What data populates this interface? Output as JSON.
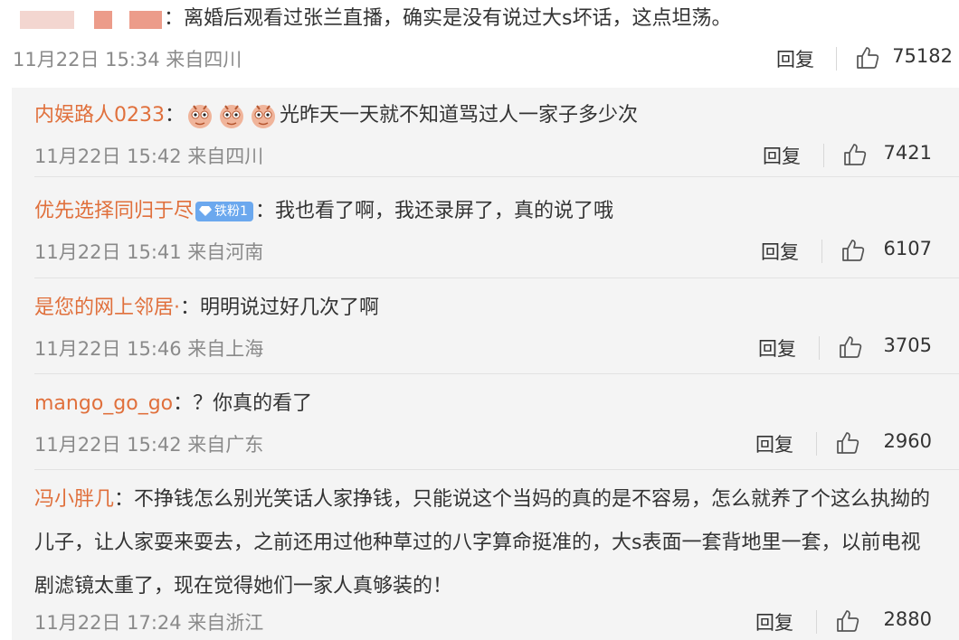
{
  "main_comment": {
    "text": "：离婚后观看过张兰直播，确实是没有说过大s坏话，这点坦荡。",
    "meta": "11月22日 15:34 来自四川",
    "reply_label": "回复",
    "likes": "75182"
  },
  "colors": {
    "username": "#e0703c",
    "panel_bg": "#f4f4f4",
    "badge": "#6ba8ee",
    "meta": "#8a8a8a"
  },
  "replies": [
    {
      "user": "内娱路人0233",
      "sep": "：",
      "text": "光昨天一天就不知道骂过人一家子多少次",
      "emojis": [
        "emoji-icon",
        "emoji-icon",
        "emoji-icon"
      ],
      "meta": "11月22日 15:42 来自四川",
      "reply_label": "回复",
      "likes": "7421"
    },
    {
      "user": "优先选择同归于尽",
      "badge": "铁粉1",
      "sep": "：",
      "text": "我也看了啊，我还录屏了，真的说了哦",
      "meta": "11月22日 15:41 来自河南",
      "reply_label": "回复",
      "likes": "6107"
    },
    {
      "user": "是您的网上邻居·",
      "sep": "：",
      "text": "明明说过好几次了啊",
      "meta": "11月22日 15:46 来自上海",
      "reply_label": "回复",
      "likes": "3705"
    },
    {
      "user": "mango_go_go",
      "sep": "：",
      "text": "？你真的看了",
      "meta": "11月22日 15:42 来自广东",
      "reply_label": "回复",
      "likes": "2960"
    },
    {
      "user": "冯小胖几",
      "sep": "：",
      "text": "不挣钱怎么别光笑话人家挣钱，只能说这个当妈的真的是不容易，怎么就养了个这么执拗的儿子，让人家耍来耍去，之前还用过他种草过的八字算命挺准的，大s表面一套背地里一套，以前电视剧滤镜太重了，现在觉得她们一家人真够装的！",
      "meta": "11月22日 17:24 来自浙江",
      "reply_label": "回复",
      "likes": "2880"
    }
  ],
  "icons": {
    "like": "thumbs-up-icon",
    "badge": "diamond-icon"
  }
}
